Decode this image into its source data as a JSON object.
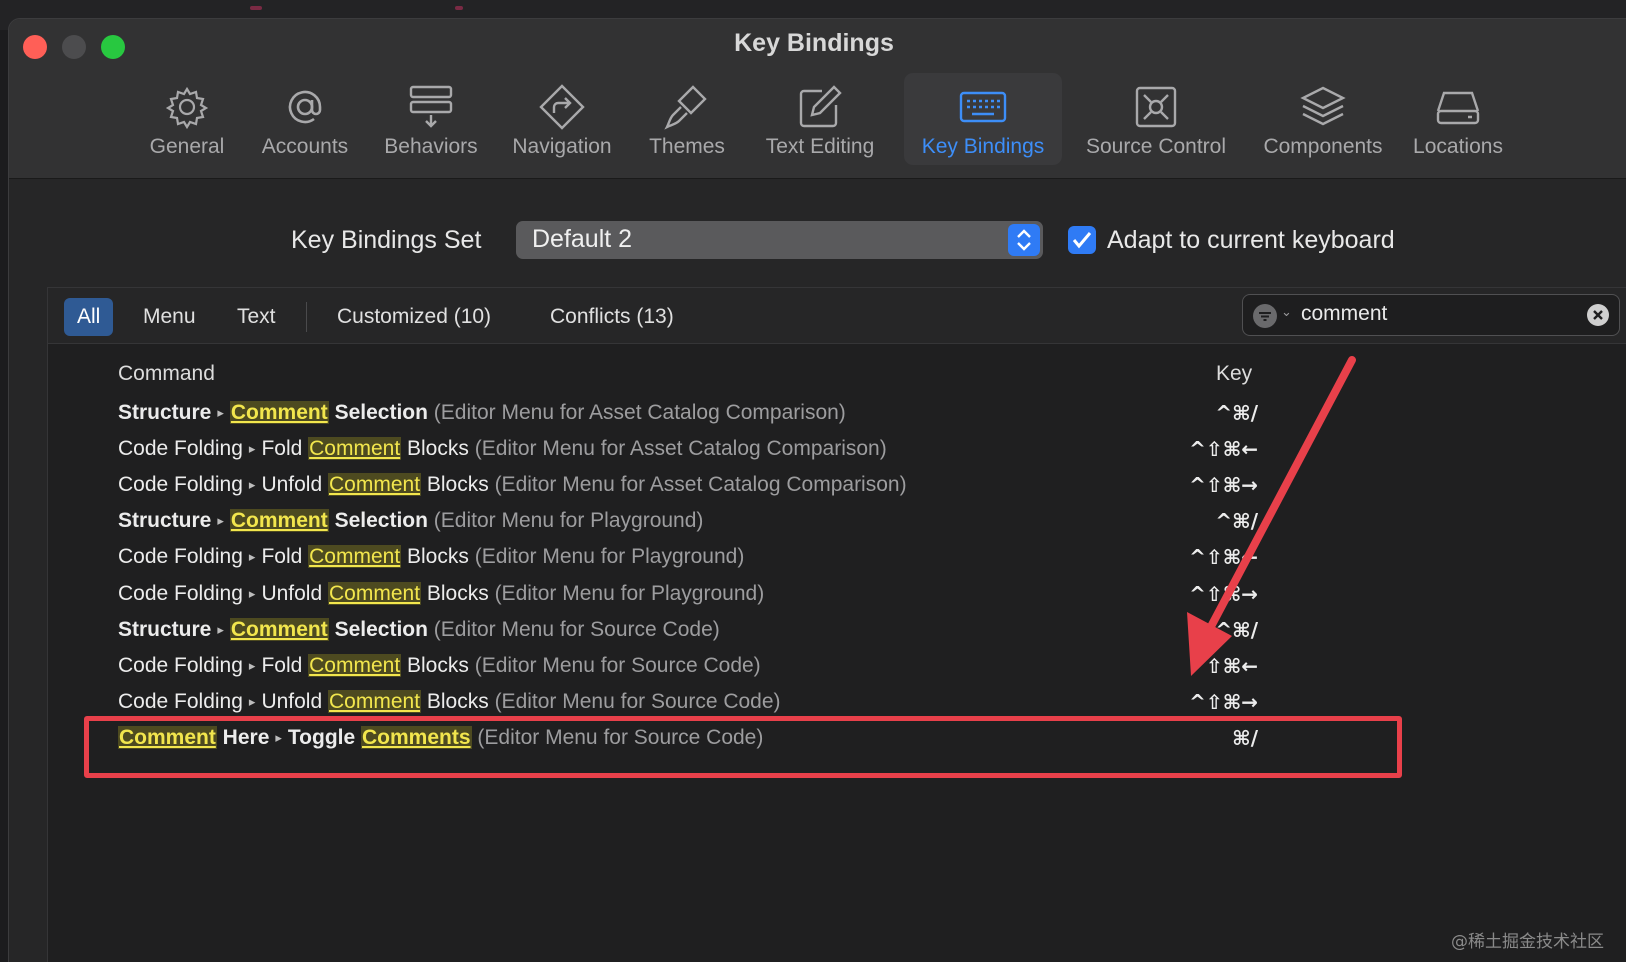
{
  "window": {
    "title": "Key Bindings"
  },
  "toolbar": {
    "items": [
      {
        "label": "General",
        "icon": "gear-icon"
      },
      {
        "label": "Accounts",
        "icon": "at-icon"
      },
      {
        "label": "Behaviors",
        "icon": "behaviors-icon"
      },
      {
        "label": "Navigation",
        "icon": "navigation-icon"
      },
      {
        "label": "Themes",
        "icon": "paintbrush-icon"
      },
      {
        "label": "Text Editing",
        "icon": "pencil-square-icon"
      },
      {
        "label": "Key Bindings",
        "icon": "keyboard-icon",
        "active": true
      },
      {
        "label": "Source Control",
        "icon": "source-control-icon"
      },
      {
        "label": "Components",
        "icon": "layers-icon"
      },
      {
        "label": "Locations",
        "icon": "drive-icon"
      }
    ]
  },
  "settings": {
    "set_label": "Key Bindings Set",
    "set_value": "Default 2",
    "adapt_label": "Adapt to current keyboard",
    "adapt_checked": true
  },
  "filters": {
    "all": "All",
    "menu": "Menu",
    "text": "Text",
    "customized": "Customized (10)",
    "conflicts": "Conflicts (13)",
    "active": "All"
  },
  "search": {
    "value": "comment"
  },
  "table": {
    "col_command": "Command",
    "col_key": "Key",
    "rows": [
      {
        "parent": "Structure",
        "pre": "",
        "match": "Comment",
        "post": " Selection",
        "context": "(Editor Menu for Asset Catalog Comparison)",
        "key": "^⌘/",
        "bold": true
      },
      {
        "parent": "Code Folding",
        "pre": "Fold ",
        "match": "Comment",
        "post": " Blocks",
        "context": "(Editor Menu for Asset Catalog Comparison)",
        "key": "^⇧⌘←",
        "bold": false
      },
      {
        "parent": "Code Folding",
        "pre": "Unfold ",
        "match": "Comment",
        "post": " Blocks",
        "context": "(Editor Menu for Asset Catalog Comparison)",
        "key": "^⇧⌘→",
        "bold": false
      },
      {
        "parent": "Structure",
        "pre": "",
        "match": "Comment",
        "post": " Selection",
        "context": "(Editor Menu for Playground)",
        "key": "^⌘/",
        "bold": true
      },
      {
        "parent": "Code Folding",
        "pre": "Fold ",
        "match": "Comment",
        "post": " Blocks",
        "context": "(Editor Menu for Playground)",
        "key": "^⇧⌘←",
        "bold": false
      },
      {
        "parent": "Code Folding",
        "pre": "Unfold ",
        "match": "Comment",
        "post": " Blocks",
        "context": "(Editor Menu for Playground)",
        "key": "^⇧⌘→",
        "bold": false
      },
      {
        "parent": "Structure",
        "pre": "",
        "match": "Comment",
        "post": " Selection",
        "context": "(Editor Menu for Source Code)",
        "key": "^⌘/",
        "bold": true
      },
      {
        "parent": "Code Folding",
        "pre": "Fold ",
        "match": "Comment",
        "post": " Blocks",
        "context": "(Editor Menu for Source Code)",
        "key": "^⇧⌘←",
        "bold": false
      },
      {
        "parent": "Code Folding",
        "pre": "Unfold ",
        "match": "Comment",
        "post": " Blocks",
        "context": "(Editor Menu for Source Code)",
        "key": "^⇧⌘→",
        "bold": false
      }
    ],
    "last_row": {
      "parent_match": "Comment",
      "parent_rest": " Here",
      "item_pre": "Toggle ",
      "item_match": "Comments",
      "context": "(Editor Menu for Source Code)",
      "key": "⌘/"
    }
  },
  "annotation": {
    "color": "#e8404a"
  },
  "watermark": "@稀土掘金技术社区",
  "colors": {
    "accent": "#2f7bf5",
    "highlight_text": "#f2e64d",
    "highlight_bg": "#4d4a20"
  }
}
